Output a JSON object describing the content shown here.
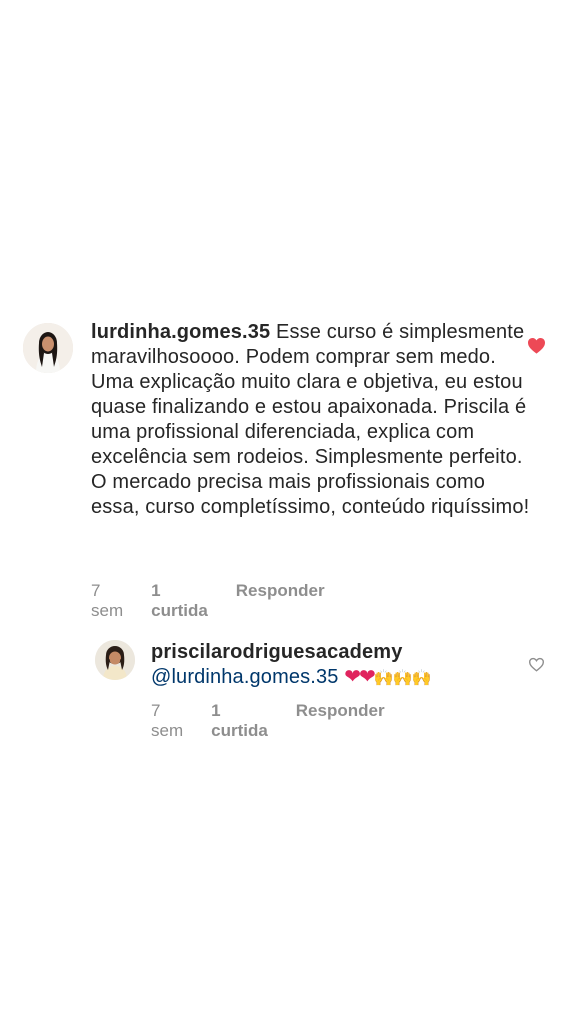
{
  "comments": [
    {
      "username": "lurdinha.gomes.35",
      "text": " Esse curso é simplesmente maravilhosoooo. Podem comprar sem medo. Uma explicação muito clara e objetiva, eu estou quase finalizando e estou apaixonada.  Priscila é uma profissional diferenciada, explica com excelência sem rodeios. Simplesmente perfeito. O mercado precisa mais profissionais como essa, curso completíssimo, conteúdo riquíssimo!",
      "time": "7 sem",
      "likes": "1 curtida",
      "reply": "Responder",
      "liked": true,
      "like_icon": "heart-filled-icon",
      "like_color": "#ed4956"
    },
    {
      "username": "priscilarodriguesacademy",
      "mention": "@lurdinha.gomes.35",
      "emojis": "❤❤",
      "hands": "🙌🙌🙌",
      "time": "7 sem",
      "likes": "1 curtida",
      "reply": "Responder",
      "liked": false,
      "like_icon": "heart-outline-icon",
      "like_color": "#8e8e8e"
    }
  ],
  "colors": {
    "text": "#262626",
    "secondary": "#8e8e8e",
    "mention": "#00376b"
  }
}
